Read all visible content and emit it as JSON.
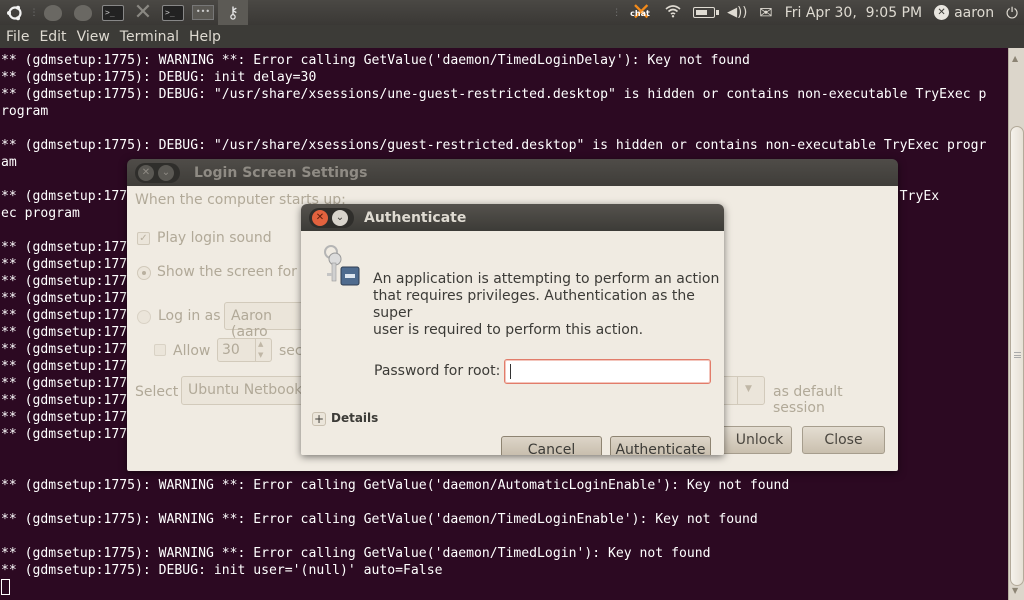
{
  "top_panel": {
    "launchers": [
      {
        "name": "ubuntu-logo-icon"
      },
      {
        "name": "footprints-icon"
      },
      {
        "name": "footprints-icon"
      },
      {
        "name": "terminal-icon"
      },
      {
        "name": "xchat-icon",
        "label": "chat"
      },
      {
        "name": "terminal-icon"
      },
      {
        "name": "authentication-dialog-icon"
      },
      {
        "name": "keys-icon"
      }
    ],
    "tray": {
      "xchat_label": "chat",
      "clock": "Fri Apr 30,  9:05 PM",
      "username": "aaron"
    }
  },
  "terminal": {
    "menu": [
      "File",
      "Edit",
      "View",
      "Terminal",
      "Help"
    ],
    "lines": [
      "** (gdmsetup:1775): WARNING **: Error calling GetValue('daemon/TimedLoginDelay'): Key not found",
      "** (gdmsetup:1775): DEBUG: init delay=30",
      "** (gdmsetup:1775): DEBUG: \"/usr/share/xsessions/une-guest-restricted.desktop\" is hidden or contains non-executable TryExec p",
      "rogram",
      "",
      "** (gdmsetup:1775): DEBUG: \"/usr/share/xsessions/guest-restricted.desktop\" is hidden or contains non-executable TryExec progr",
      "am",
      "",
      "** (gdmsetup:1775): DEBUG: \"/usr/share/xsessions/ubuntu-netbook-efl.desktop\" is hidden or contains non-executable TryEx",
      "ec program",
      "",
      "** (gdmsetup:177",
      "** (gdmsetup:177",
      "** (gdmsetup:177",
      "** (gdmsetup:177",
      "** (gdmsetup:177",
      "** (gdmsetup:177",
      "** (gdmsetup:177",
      "** (gdmsetup:177",
      "** (gdmsetup:177",
      "** (gdmsetup:177",
      "** (gdmsetup:177",
      "** (gdmsetup:177",
      "",
      "",
      "** (gdmsetup:1775): WARNING **: Error calling GetValue('daemon/AutomaticLoginEnable'): Key not found",
      "",
      "** (gdmsetup:1775): WARNING **: Error calling GetValue('daemon/TimedLoginEnable'): Key not found",
      "",
      "** (gdmsetup:1775): WARNING **: Error calling GetValue('daemon/TimedLogin'): Key not found",
      "** (gdmsetup:1775): DEBUG: init user='(null)' auto=False"
    ]
  },
  "login_settings": {
    "title": "Login Screen Settings",
    "heading": "When the computer starts up:",
    "play_sound": {
      "label": "Play login sound",
      "checked": true
    },
    "show_screen": {
      "label": "Show the screen for ch",
      "selected": true
    },
    "log_in_as": {
      "label": "Log in as",
      "value": "Aaron (aaro"
    },
    "allow": {
      "label": "Allow",
      "value": "30",
      "suffix": "sec",
      "checked": false
    },
    "select": {
      "label": "Select",
      "value": "Ubuntu Netbook E",
      "suffix": "as default session"
    },
    "buttons": {
      "unlock": "Unlock",
      "close": "Close"
    }
  },
  "auth_dialog": {
    "title": "Authenticate",
    "message": [
      "An application is attempting to perform an action",
      "that requires privileges. Authentication as the super",
      "user is required to perform this action."
    ],
    "password_label": "Password for root:",
    "password_value": "",
    "details_label": "Details",
    "buttons": {
      "cancel": "Cancel",
      "authenticate": "Authenticate"
    }
  },
  "colors": {
    "terminal_bg": "#2c0922",
    "panel_bg": "#3c3b37",
    "dialog_bg": "#f0ebe2",
    "close_button": "#e2623e",
    "focus_border": "#e27c6a"
  }
}
